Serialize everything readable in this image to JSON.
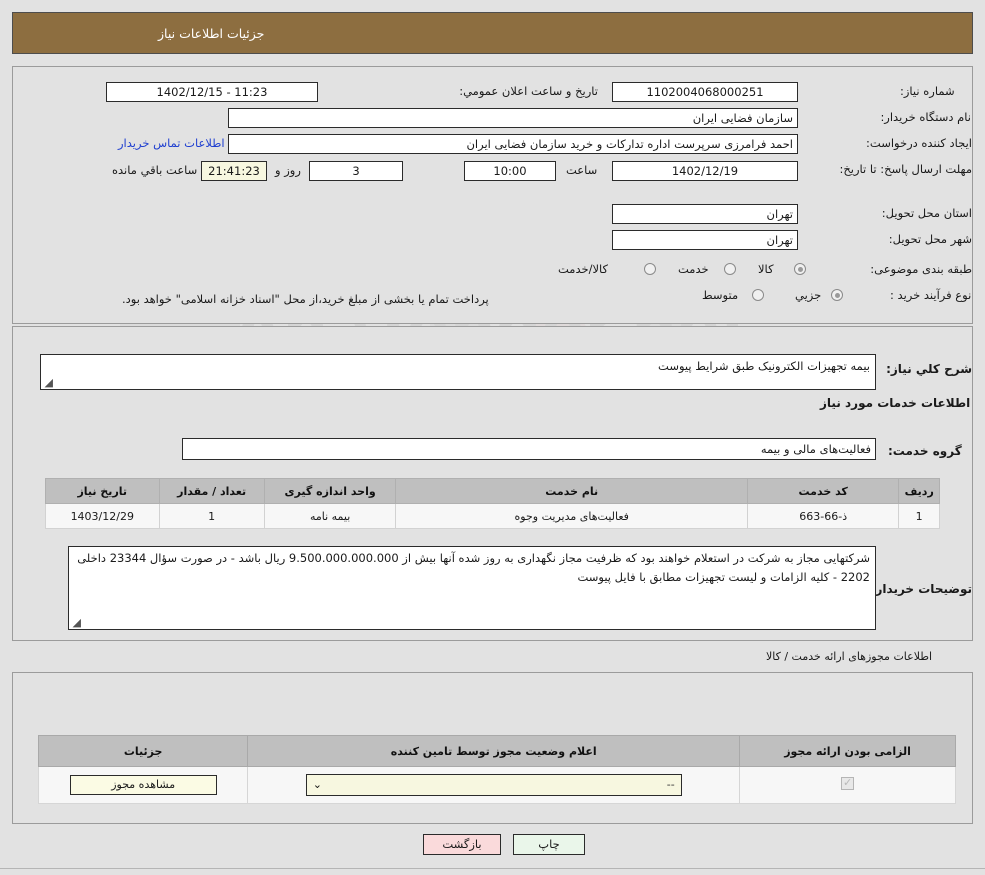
{
  "header": {
    "title": "جزئیات اطلاعات نیاز"
  },
  "top": {
    "labels": {
      "need_number": "شماره نیاز:",
      "buyer_org": "نام دستگاه خریدار:",
      "request_creator": "ایجاد کننده درخواست:",
      "deadline": "مهلت ارسال پاسخ: تا تاریخ:",
      "province": "استان محل تحویل:",
      "city": "شهر محل تحویل:",
      "classification": "طبقه بندی موضوعی:",
      "purchase_type": "نوع فرآیند خرید :",
      "public_announce": "تاریخ و ساعت اعلان عمومي:",
      "hour": "ساعت",
      "day_and": "روز و",
      "time_left": "ساعت باقي مانده"
    },
    "values": {
      "need_number": "1102004068000251",
      "buyer_org": "سازمان فضایی ایران",
      "request_creator": "احمد فرامرزی سرپرست اداره تدارکات و خرید سازمان فضایی ایران",
      "contact_link": "اطلاعات تماس خریدار",
      "public_announce": "11:23 - 1402/12/15",
      "deadline_date": "1402/12/19",
      "deadline_hour": "10:00",
      "days_left": "3",
      "time_left": "21:41:23",
      "province": "تهران",
      "city": "تهران"
    },
    "classification_options": [
      {
        "label": "کالا",
        "selected": true
      },
      {
        "label": "خدمت",
        "selected": false
      },
      {
        "label": "کالا/خدمت",
        "selected": false
      }
    ],
    "purchase_options": [
      {
        "label": "جزیي",
        "selected": true
      },
      {
        "label": "متوسط",
        "selected": false
      }
    ],
    "purchase_note": "پرداخت تمام یا بخشی از مبلغ خرید،از محل \"اسناد خزانه اسلامی\" خواهد بود."
  },
  "mid": {
    "labels": {
      "general_desc": "شرح کلي نیاز:",
      "services_info": "اطلاعات خدمات مورد نیاز",
      "service_group": "گروه خدمت:",
      "buyer_notes": "توضیحات خریدار:"
    },
    "values": {
      "general_desc": "بیمه تجهیزات الکترونیک طبق شرایط پیوست",
      "service_group": "فعالیت‌های مالی و بیمه",
      "buyer_notes": "شرکتهایی مجاز به شرکت در استعلام خواهند بود که ظرفیت مجاز نگهداری به روز شده آنها بیش از 9.500.000.000.000 ریال باشد - در صورت سؤال 23344 داخلی 2202 - کلیه الزامات و لیست تجهیزات مطابق با فایل پیوست"
    },
    "table": {
      "headers": [
        "ردیف",
        "کد خدمت",
        "نام خدمت",
        "واحد اندازه گیری",
        "تعداد / مقدار",
        "تاریخ نیاز"
      ],
      "rows": [
        [
          "1",
          "ذ-66-663",
          "فعالیت‌های مدیریت وجوه",
          "بیمه نامه",
          "1",
          "1403/12/29"
        ]
      ]
    }
  },
  "bottom": {
    "section_title": "اطلاعات مجوزهای ارائه خدمت / کالا",
    "table": {
      "headers": [
        "الزامی بودن ارائه مجوز",
        "اعلام وضعیت مجوز توسط تامین کننده",
        "جزئیات"
      ],
      "rows": [
        {
          "required": true,
          "status_value": "--",
          "detail_button": "مشاهده مجوز"
        }
      ]
    }
  },
  "footer": {
    "print_button": "چاپ",
    "back_button": "بازگشت"
  },
  "watermark": {
    "text": "AnaTender.net"
  },
  "colors": {
    "header_bar": "#8d6e40",
    "page_bg": "#e2e2e2",
    "link": "#1f3fd0",
    "table_header": "#bfbfbf",
    "print_button": "#eaf6ea",
    "back_button": "#fadadb",
    "highlight_field": "#f7f7e0"
  }
}
